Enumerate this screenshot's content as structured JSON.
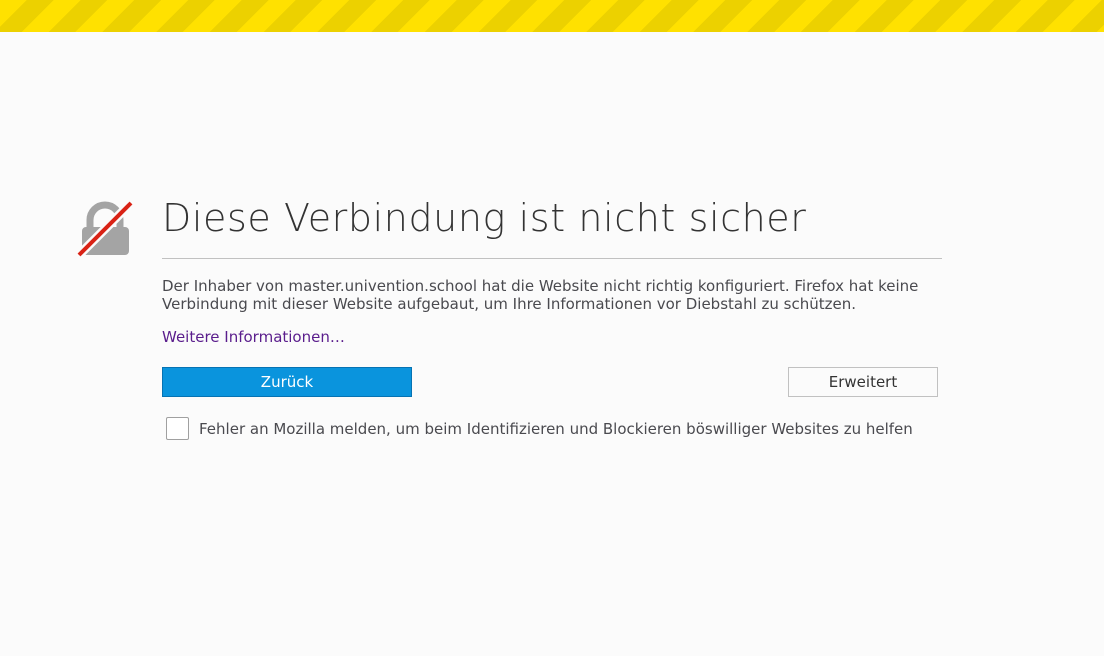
{
  "error_page": {
    "title": "Diese Verbindung ist nicht sicher",
    "description": "Der Inhaber von master.univention.school hat die Website nicht richtig konfiguriert. Firefox hat keine Verbindung mit dieser Website aufgebaut, um Ihre Informationen vor Diebstahl zu schützen.",
    "learn_more_link": "Weitere Informationen…",
    "back_button": "Zurück",
    "advanced_button": "Erweitert",
    "report_checkbox_label": "Fehler an Mozilla melden, um beim Identifizieren und Blockieren böswilliger Websites zu helfen",
    "report_checked": false,
    "icon": "broken-lock-icon"
  },
  "colors": {
    "warning_stripe_yellow": "#ffe100",
    "primary_button_blue": "#0a94dd",
    "link_purple": "#5a1d8c",
    "icon_strike_red": "#d92215",
    "icon_lock_gray": "#a4a4a4"
  }
}
